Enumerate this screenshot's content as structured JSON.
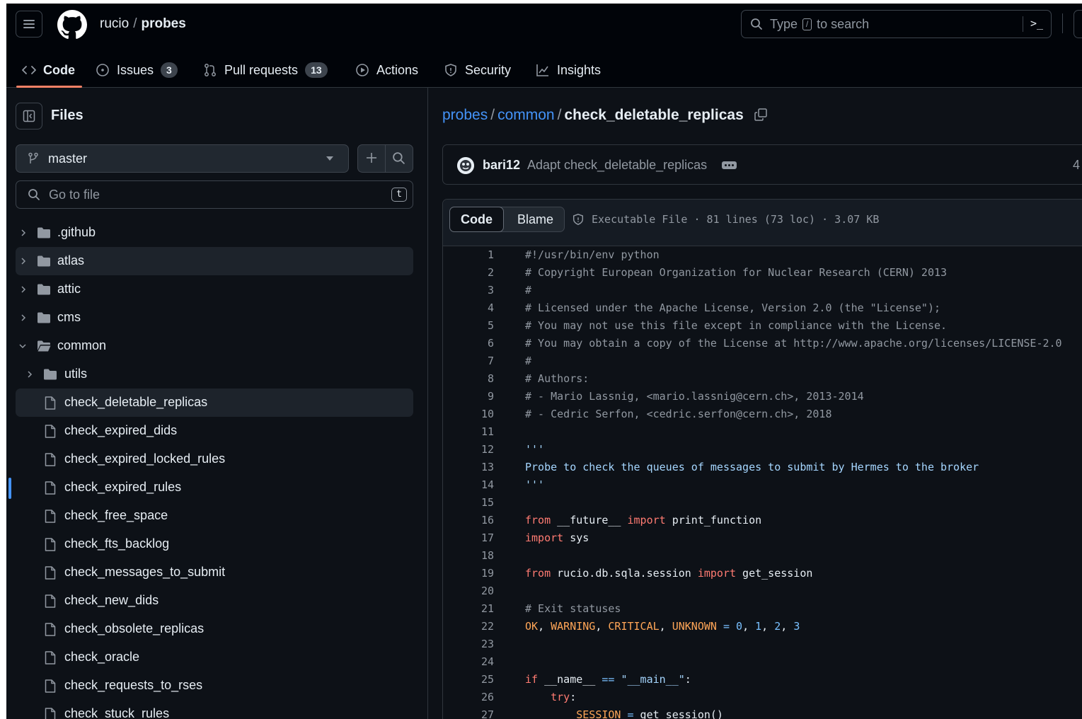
{
  "repo": {
    "owner": "rucio",
    "name": "probes"
  },
  "search": {
    "prefix": "Type",
    "key": "/",
    "suffix": "to search",
    "cmd": ">_"
  },
  "tabs": [
    {
      "label": "Code"
    },
    {
      "label": "Issues",
      "count": "3"
    },
    {
      "label": "Pull requests",
      "count": "13"
    },
    {
      "label": "Actions"
    },
    {
      "label": "Security"
    },
    {
      "label": "Insights"
    }
  ],
  "sidebar": {
    "title": "Files",
    "branch": "master",
    "goto_placeholder": "Go to file",
    "goto_key": "t",
    "tree": [
      {
        "label": ".github",
        "type": "folder"
      },
      {
        "label": "atlas",
        "type": "folder"
      },
      {
        "label": "attic",
        "type": "folder"
      },
      {
        "label": "cms",
        "type": "folder"
      },
      {
        "label": "common",
        "type": "folder-open"
      },
      {
        "label": "utils",
        "type": "folder"
      },
      {
        "label": "check_deletable_replicas",
        "type": "file"
      },
      {
        "label": "check_expired_dids",
        "type": "file"
      },
      {
        "label": "check_expired_locked_rules",
        "type": "file"
      },
      {
        "label": "check_expired_rules",
        "type": "file"
      },
      {
        "label": "check_free_space",
        "type": "file"
      },
      {
        "label": "check_fts_backlog",
        "type": "file"
      },
      {
        "label": "check_messages_to_submit",
        "type": "file"
      },
      {
        "label": "check_new_dids",
        "type": "file"
      },
      {
        "label": "check_obsolete_replicas",
        "type": "file"
      },
      {
        "label": "check_oracle",
        "type": "file"
      },
      {
        "label": "check_requests_to_rses",
        "type": "file"
      },
      {
        "label": "check_stuck_rules",
        "type": "file"
      }
    ]
  },
  "path": {
    "root": "probes",
    "dir": "common",
    "file": "check_deletable_replicas"
  },
  "commit": {
    "author": "bari12",
    "message": "Adapt check_deletable_replicas",
    "trailing": "4"
  },
  "file": {
    "tab_code": "Code",
    "tab_blame": "Blame",
    "info": "Executable File · 81 lines (73 loc) · 3.07 KB"
  },
  "code_lines": [
    "#!/usr/bin/env python",
    "# Copyright European Organization for Nuclear Research (CERN) 2013",
    "#",
    "# Licensed under the Apache License, Version 2.0 (the \"License\");",
    "# You may not use this file except in compliance with the License.",
    "# You may obtain a copy of the License at http://www.apache.org/licenses/LICENSE-2.0",
    "#",
    "# Authors:",
    "# - Mario Lassnig, <mario.lassnig@cern.ch>, 2013-2014",
    "# - Cedric Serfon, <cedric.serfon@cern.ch>, 2018",
    "",
    "'''",
    "Probe to check the queues of messages to submit by Hermes to the broker",
    "'''",
    "",
    "from __future__ import print_function",
    "import sys",
    "",
    "from rucio.db.sqla.session import get_session",
    "",
    "# Exit statuses",
    "OK, WARNING, CRITICAL, UNKNOWN = 0, 1, 2, 3",
    "",
    "",
    "if __name__ == \"__main__\":",
    "    try:",
    "        SESSION = get_session()"
  ],
  "colors": {
    "accent": "#4493f8",
    "tab_underline": "#f78166",
    "keyword": "#ff7b72",
    "string": "#a5d6ff",
    "constant": "#79c0ff",
    "name": "#ffa657"
  }
}
